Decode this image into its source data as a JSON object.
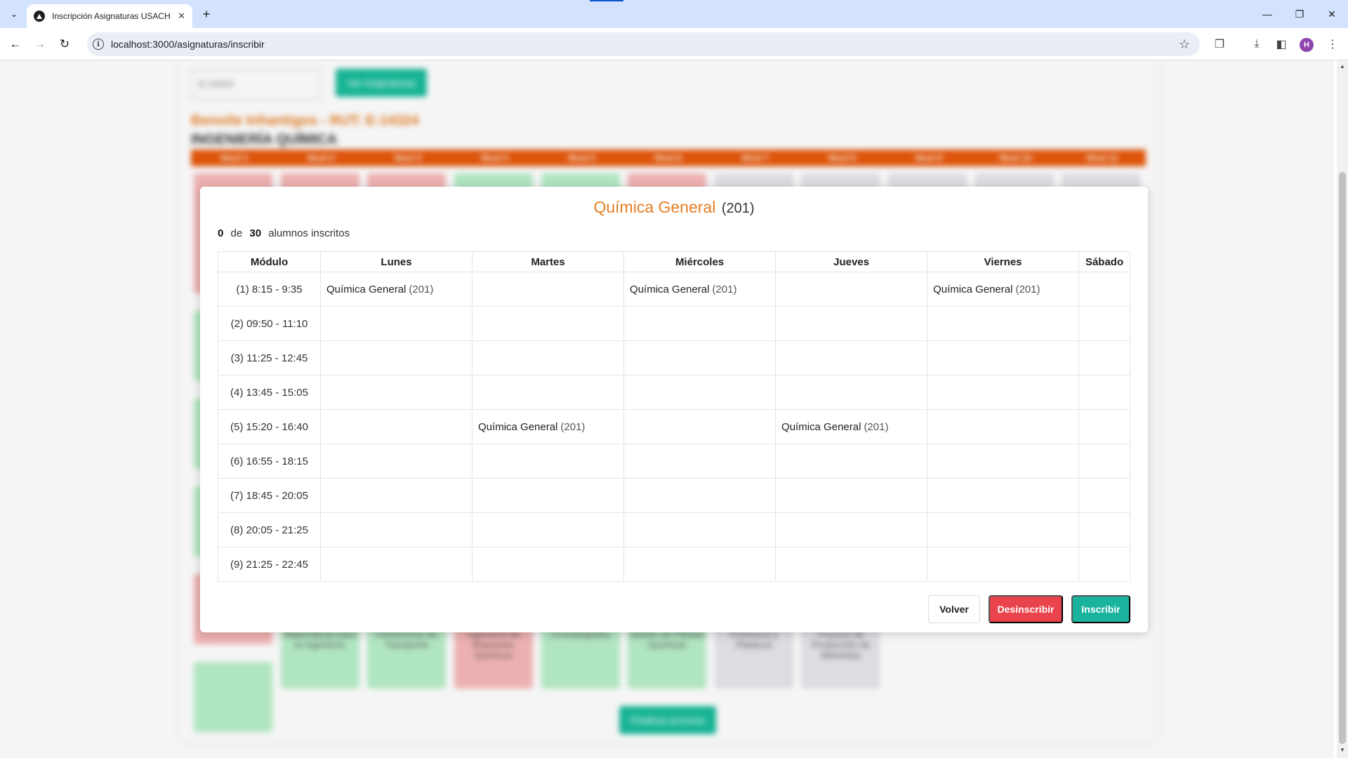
{
  "browser": {
    "tab_title": "Inscripción Asignaturas USACH",
    "tab_close": "✕",
    "new_tab": "+",
    "url": "localhost:3000/asignaturas/inscribir",
    "profile_initial": "H",
    "window": {
      "minimize": "—",
      "restore": "❐",
      "close": "✕"
    }
  },
  "background_page": {
    "rut_input": "E-14324",
    "search_button": "Ver Asignaturas",
    "student": "Benoite Inhantigos - RUT: E-14324",
    "career": "INGENIERÍA QUÍMICA",
    "levels": [
      "Nivel 1",
      "Nivel 2",
      "Nivel 3",
      "Nivel 4",
      "Nivel 5",
      "Nivel 6",
      "Nivel 7",
      "Nivel 8",
      "Nivel 9",
      "Nivel 10",
      "Nivel 11"
    ],
    "bottom_courses": [
      {
        "label": "Matemáticas para la Ingeniería",
        "status": "approved"
      },
      {
        "label": "Fenómenos de Transporte",
        "status": "approved"
      },
      {
        "label": "Ingeniería de Reactores Químicos",
        "status": "failed"
      },
      {
        "label": "Cromatografía",
        "status": "approved"
      },
      {
        "label": "Diseño de Plantas Químicas",
        "status": "approved"
      },
      {
        "label": "Polímeros y Plásticos",
        "status": "pending"
      },
      {
        "label": "Proceso de Producción de Alimentos",
        "status": "pending"
      }
    ],
    "finish_button": "Finalizar proceso",
    "colors": {
      "approved": "#b8efc9",
      "failed": "#f7b8b8",
      "pending": "#e4e6ea"
    }
  },
  "modal": {
    "course_name": "Química General",
    "course_section": "(201)",
    "enrolled": "0",
    "of_label": "de",
    "capacity": "30",
    "enrolled_label": "alumnos inscritos",
    "headers": [
      "Módulo",
      "Lunes",
      "Martes",
      "Miércoles",
      "Jueves",
      "Viernes",
      "Sábado"
    ],
    "rows": [
      {
        "module": "(1) 8:15 - 9:35",
        "cells": [
          "Química General|(201)",
          "",
          "Química General|(201)",
          "",
          "Química General|(201)",
          ""
        ]
      },
      {
        "module": "(2) 09:50 - 11:10",
        "cells": [
          "",
          "",
          "",
          "",
          "",
          ""
        ]
      },
      {
        "module": "(3) 11:25 - 12:45",
        "cells": [
          "",
          "",
          "",
          "",
          "",
          ""
        ]
      },
      {
        "module": "(4) 13:45 - 15:05",
        "cells": [
          "",
          "",
          "",
          "",
          "",
          ""
        ]
      },
      {
        "module": "(5) 15:20 - 16:40",
        "cells": [
          "",
          "Química General|(201)",
          "",
          "Química General|(201)",
          "",
          ""
        ]
      },
      {
        "module": "(6) 16:55 - 18:15",
        "cells": [
          "",
          "",
          "",
          "",
          "",
          ""
        ]
      },
      {
        "module": "(7) 18:45 - 20:05",
        "cells": [
          "",
          "",
          "",
          "",
          "",
          ""
        ]
      },
      {
        "module": "(8) 20:05 - 21:25",
        "cells": [
          "",
          "",
          "",
          "",
          "",
          ""
        ]
      },
      {
        "module": "(9) 21:25 - 22:45",
        "cells": [
          "",
          "",
          "",
          "",
          "",
          ""
        ]
      }
    ],
    "buttons": {
      "back": "Volver",
      "unenroll": "Desinscribir",
      "enroll": "Inscribir"
    },
    "colors": {
      "title": "#e67e22",
      "unenroll": "#e9434b",
      "enroll": "#1ab49e"
    }
  }
}
